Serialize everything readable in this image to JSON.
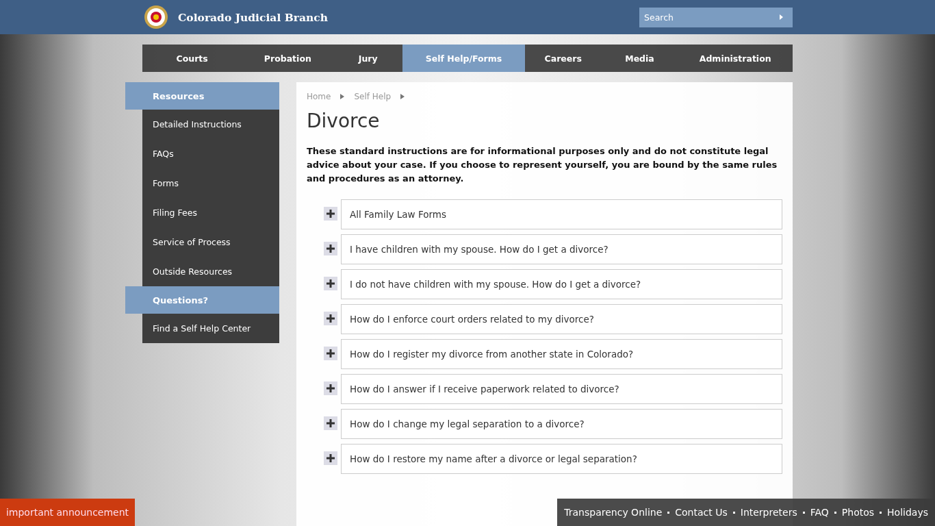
{
  "header": {
    "title": "Colorado Judicial Branch",
    "search": {
      "placeholder": "Search"
    }
  },
  "nav": [
    {
      "label": "Courts",
      "selected": false
    },
    {
      "label": "Probation",
      "selected": false
    },
    {
      "label": "Jury",
      "selected": false
    },
    {
      "label": "Self Help/Forms",
      "selected": true
    },
    {
      "label": "Careers",
      "selected": false
    },
    {
      "label": "Media",
      "selected": false
    },
    {
      "label": "Administration",
      "selected": false
    }
  ],
  "sidebar": [
    {
      "kind": "heading",
      "label": "Resources"
    },
    {
      "kind": "link",
      "label": "Detailed Instructions"
    },
    {
      "kind": "link",
      "label": "FAQs"
    },
    {
      "kind": "link",
      "label": "Forms"
    },
    {
      "kind": "link",
      "label": "Filing Fees"
    },
    {
      "kind": "link",
      "label": "Service of Process"
    },
    {
      "kind": "link",
      "label": "Outside Resources"
    },
    {
      "kind": "heading",
      "label": "Questions?"
    },
    {
      "kind": "link",
      "label": "Find a Self Help Center"
    }
  ],
  "breadcrumbs": [
    "Home",
    "Self Help"
  ],
  "title": "Divorce",
  "intro": "These standard instructions are for informational purposes only and do not constitute legal advice about your case. If you choose to represent yourself, you are bound by the same rules and procedures as an attorney.",
  "accordion": [
    {
      "label": "All Family Law Forms",
      "expanded": false
    },
    {
      "label": "I have children with my spouse. How do I get a divorce?",
      "expanded": false
    },
    {
      "label": "I do not have children with my spouse. How do I get a divorce?",
      "expanded": false
    },
    {
      "label": "How do I enforce court orders related to my divorce?",
      "expanded": false
    },
    {
      "label": "How do I register my divorce from another state in Colorado?",
      "expanded": false
    },
    {
      "label": "How do I answer if I receive paperwork related to divorce?",
      "expanded": false
    },
    {
      "label": "How do I change my legal separation to a divorce?",
      "expanded": false
    },
    {
      "label": "How do I restore my name after a divorce or legal separation?",
      "expanded": false
    }
  ],
  "announcement": "important announcement",
  "footer_links": [
    "Transparency Online",
    "Contact Us",
    "Interpreters",
    "FAQ",
    "Photos",
    "Holidays"
  ]
}
